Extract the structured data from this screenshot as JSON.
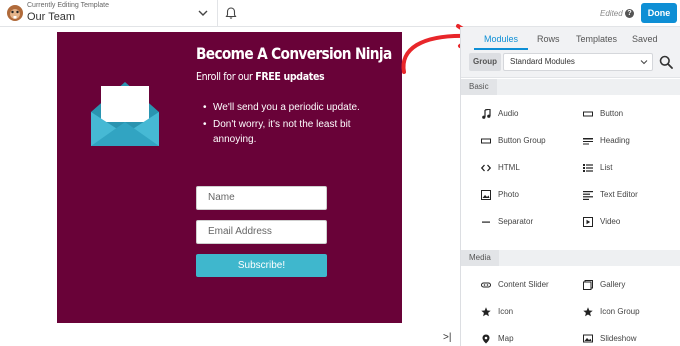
{
  "topbar": {
    "subtitle": "Currently Editing Template",
    "title": "Our Team",
    "status": "Edited",
    "help": "?",
    "done_label": "Done"
  },
  "card": {
    "title": "Become A Conversion Ninja",
    "subtitle_prefix": "Enroll for our ",
    "subtitle_bold": "FREE updates",
    "bullets": [
      "We'll send you a periodic update.",
      "Don't worry, it's not the least bit annoying."
    ],
    "name_placeholder": "Name",
    "email_placeholder": "Email Address",
    "subscribe_label": "Subscribe!",
    "background": "#690238",
    "button_color": "#3fb7cd"
  },
  "panel": {
    "tabs": [
      "Modules",
      "Rows",
      "Templates",
      "Saved"
    ],
    "active_tab": "Modules",
    "group_label": "Group",
    "group_value": "Standard Modules",
    "sections": [
      {
        "name": "Basic",
        "modules": [
          {
            "label": "Audio",
            "icon": "music-note-icon"
          },
          {
            "label": "Button",
            "icon": "button-icon"
          },
          {
            "label": "Button Group",
            "icon": "button-group-icon"
          },
          {
            "label": "Heading",
            "icon": "heading-icon"
          },
          {
            "label": "HTML",
            "icon": "code-icon"
          },
          {
            "label": "List",
            "icon": "list-icon"
          },
          {
            "label": "Photo",
            "icon": "photo-icon"
          },
          {
            "label": "Text Editor",
            "icon": "text-editor-icon"
          },
          {
            "label": "Separator",
            "icon": "separator-icon"
          },
          {
            "label": "Video",
            "icon": "video-icon"
          }
        ]
      },
      {
        "name": "Media",
        "modules": [
          {
            "label": "Content Slider",
            "icon": "content-slider-icon"
          },
          {
            "label": "Gallery",
            "icon": "gallery-icon"
          },
          {
            "label": "Icon",
            "icon": "star-icon"
          },
          {
            "label": "Icon Group",
            "icon": "star-icon"
          },
          {
            "label": "Map",
            "icon": "map-pin-icon"
          },
          {
            "label": "Slideshow",
            "icon": "slideshow-icon"
          }
        ]
      }
    ]
  },
  "colors": {
    "accent": "#0e8fd5",
    "arrow": "#e8262a"
  }
}
